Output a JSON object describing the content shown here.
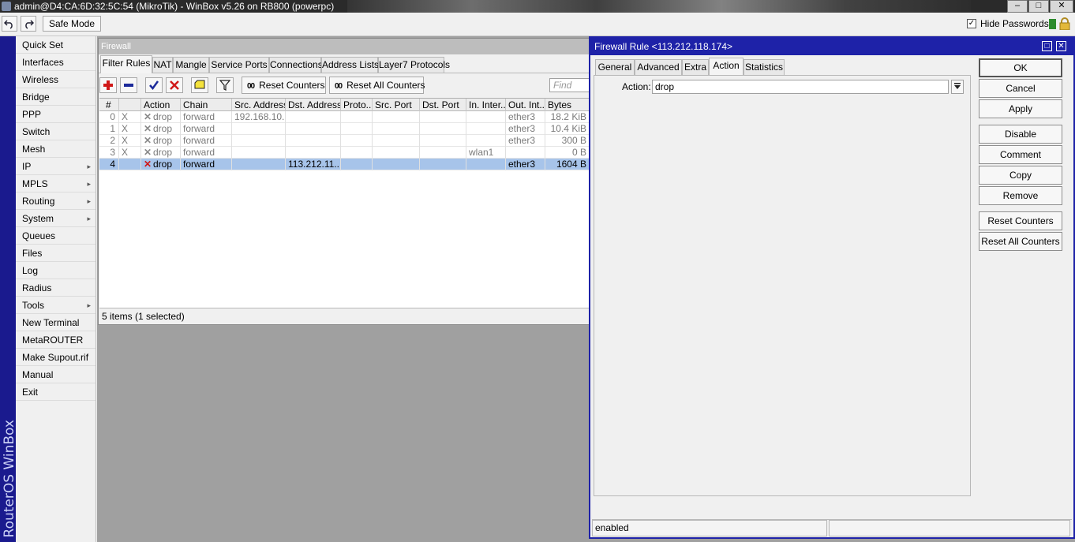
{
  "window": {
    "title": "admin@D4:CA:6D:32:5C:54 (MikroTik) - WinBox v5.26 on RB800 (powerpc)",
    "minimize": "–",
    "maximize": "□",
    "close": "✕"
  },
  "toolbar": {
    "undo_icon": "undo-icon",
    "redo_icon": "redo-icon",
    "safe_mode": "Safe Mode",
    "hide_passwords": "Hide Passwords",
    "hide_passwords_checked": true,
    "status_color": "#2e8b2e"
  },
  "sidebar_brand": "RouterOS WinBox",
  "menu": {
    "items": [
      {
        "label": "Quick Set",
        "submenu": false
      },
      {
        "label": "Interfaces",
        "submenu": false
      },
      {
        "label": "Wireless",
        "submenu": false
      },
      {
        "label": "Bridge",
        "submenu": false
      },
      {
        "label": "PPP",
        "submenu": false
      },
      {
        "label": "Switch",
        "submenu": false
      },
      {
        "label": "Mesh",
        "submenu": false
      },
      {
        "label": "IP",
        "submenu": true
      },
      {
        "label": "MPLS",
        "submenu": true
      },
      {
        "label": "Routing",
        "submenu": true
      },
      {
        "label": "System",
        "submenu": true
      },
      {
        "label": "Queues",
        "submenu": false
      },
      {
        "label": "Files",
        "submenu": false
      },
      {
        "label": "Log",
        "submenu": false
      },
      {
        "label": "Radius",
        "submenu": false
      },
      {
        "label": "Tools",
        "submenu": true
      },
      {
        "label": "New Terminal",
        "submenu": false
      },
      {
        "label": "MetaROUTER",
        "submenu": false
      },
      {
        "label": "Make Supout.rif",
        "submenu": false
      },
      {
        "label": "Manual",
        "submenu": false
      },
      {
        "label": "Exit",
        "submenu": false
      }
    ]
  },
  "firewall": {
    "title": "Firewall",
    "tabs": [
      "Filter Rules",
      "NAT",
      "Mangle",
      "Service Ports",
      "Connections",
      "Address Lists",
      "Layer7 Protocols"
    ],
    "active_tab": "Filter Rules",
    "reset_counters": "Reset Counters",
    "reset_all_counters": "Reset All Counters",
    "counter_glyph": "00",
    "find_placeholder": "Find",
    "columns": [
      "#",
      "",
      "Action",
      "Chain",
      "Src. Address",
      "Dst. Address",
      "Proto...",
      "Src. Port",
      "Dst. Port",
      "In. Inter...",
      "Out. Int...",
      "Bytes"
    ],
    "rows": [
      {
        "num": "0",
        "flag": "X",
        "action": "drop",
        "chain": "forward",
        "src": "192.168.10...",
        "dst": "",
        "proto": "",
        "sport": "",
        "dport": "",
        "inif": "",
        "outif": "ether3",
        "bytes": "18.2 KiB",
        "selected": false
      },
      {
        "num": "1",
        "flag": "X",
        "action": "drop",
        "chain": "forward",
        "src": "",
        "dst": "",
        "proto": "",
        "sport": "",
        "dport": "",
        "inif": "",
        "outif": "ether3",
        "bytes": "10.4 KiB",
        "selected": false
      },
      {
        "num": "2",
        "flag": "X",
        "action": "drop",
        "chain": "forward",
        "src": "",
        "dst": "",
        "proto": "",
        "sport": "",
        "dport": "",
        "inif": "",
        "outif": "ether3",
        "bytes": "300 B",
        "selected": false
      },
      {
        "num": "3",
        "flag": "X",
        "action": "drop",
        "chain": "forward",
        "src": "",
        "dst": "",
        "proto": "",
        "sport": "",
        "dport": "",
        "inif": "wlan1",
        "outif": "",
        "bytes": "0 B",
        "selected": false
      },
      {
        "num": "4",
        "flag": "",
        "action": "drop",
        "chain": "forward",
        "src": "",
        "dst": "113.212.11...",
        "proto": "",
        "sport": "",
        "dport": "",
        "inif": "",
        "outif": "ether3",
        "bytes": "1604 B",
        "selected": true
      }
    ],
    "status": "5 items (1 selected)"
  },
  "rule_dialog": {
    "title": "Firewall Rule <113.212.118.174>",
    "tabs": [
      "General",
      "Advanced",
      "Extra",
      "Action",
      "Statistics"
    ],
    "active_tab": "Action",
    "action_label": "Action:",
    "action_value": "drop",
    "buttons": [
      "OK",
      "Cancel",
      "Apply",
      "Disable",
      "Comment",
      "Copy",
      "Remove",
      "Reset Counters",
      "Reset All Counters"
    ],
    "status": "enabled"
  }
}
